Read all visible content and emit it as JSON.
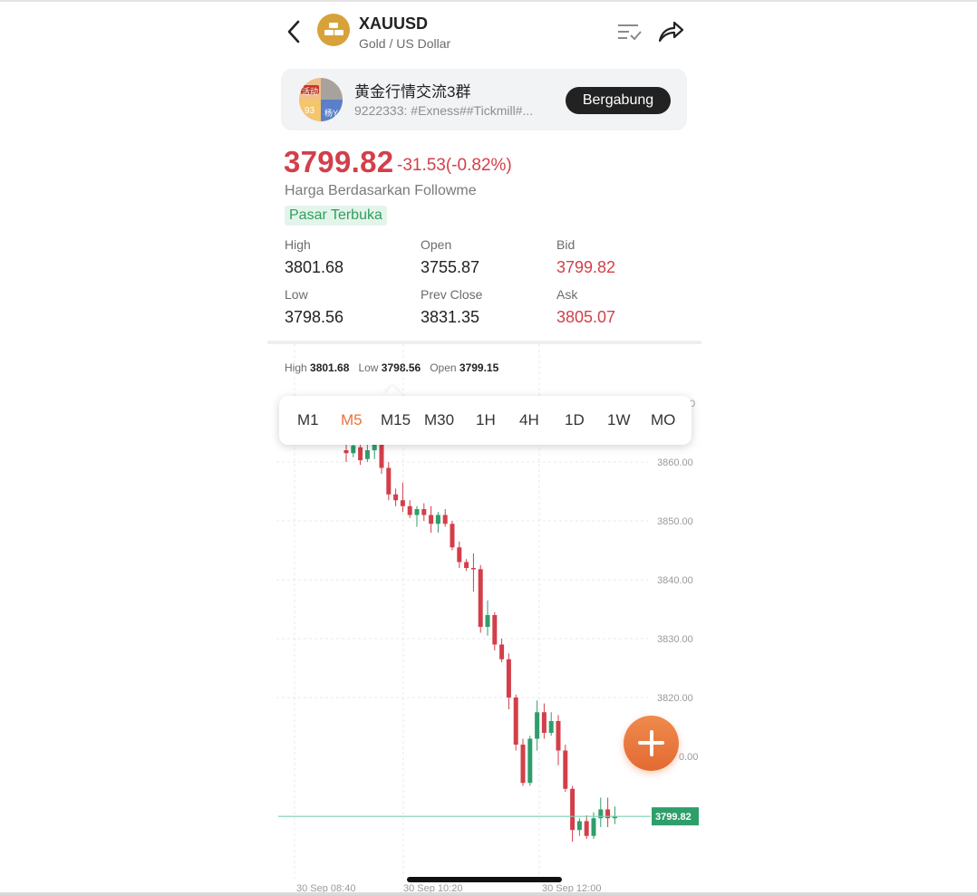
{
  "header": {
    "symbol": "XAUUSD",
    "name": "Gold / US Dollar"
  },
  "group": {
    "title": "黄金行情交流3群",
    "description": "9222333: #Exness##Tickmill#...",
    "join_label": "Bergabung",
    "avatar_texts": [
      "活动",
      "93",
      "杨Y"
    ]
  },
  "quote": {
    "price": "3799.82",
    "change": "-31.53(-0.82%)",
    "source": "Harga Berdasarkan Followme",
    "status": "Pasar Terbuka",
    "stats": [
      {
        "label": "High",
        "value": "3801.68",
        "tone": "normal"
      },
      {
        "label": "Open",
        "value": "3755.87",
        "tone": "normal"
      },
      {
        "label": "Bid",
        "value": "3799.82",
        "tone": "red"
      },
      {
        "label": "Low",
        "value": "3798.56",
        "tone": "normal"
      },
      {
        "label": "Prev Close",
        "value": "3831.35",
        "tone": "normal"
      },
      {
        "label": "Ask",
        "value": "3805.07",
        "tone": "red"
      }
    ]
  },
  "chart_header": {
    "high_label": "High",
    "high": "3801.68",
    "low_label": "Low",
    "low": "3798.56",
    "open_label": "Open",
    "open": "3799.15"
  },
  "timeframes": {
    "items": [
      "M1",
      "M5",
      "M15",
      "M30",
      "1H",
      "4H",
      "1D",
      "1W",
      "MO"
    ],
    "selected": "M5"
  },
  "colors": {
    "up": "#2e9e6b",
    "down": "#d23f4a",
    "accent": "#e8743d",
    "price_line": "#7fcfb0"
  },
  "icons": {
    "back": "chevron-left-icon",
    "list": "list-check-icon",
    "share": "share-icon",
    "fab": "plus-icon"
  },
  "chart_data": {
    "type": "candlestick",
    "y_ticks": [
      "3860.00",
      "3850.00",
      "3840.00",
      "3830.00",
      "3820.00"
    ],
    "y_partial_labels": [
      "0",
      "0.00"
    ],
    "x_ticks": [
      "30 Sep 08:40",
      "30 Sep 10:20",
      "30 Sep 12:00"
    ],
    "current_price_label": "3799.82",
    "candles": [
      {
        "o": 3862.0,
        "h": 3864.5,
        "l": 3860.0,
        "c": 3861.5
      },
      {
        "o": 3861.5,
        "h": 3863.0,
        "l": 3860.8,
        "c": 3862.8
      },
      {
        "o": 3862.5,
        "h": 3864.0,
        "l": 3859.5,
        "c": 3860.3
      },
      {
        "o": 3860.5,
        "h": 3863.0,
        "l": 3860.0,
        "c": 3862.0
      },
      {
        "o": 3862.0,
        "h": 3864.5,
        "l": 3860.5,
        "c": 3863.0
      },
      {
        "o": 3863.0,
        "h": 3864.0,
        "l": 3858.0,
        "c": 3859.0
      },
      {
        "o": 3859.0,
        "h": 3860.0,
        "l": 3853.5,
        "c": 3854.5
      },
      {
        "o": 3854.5,
        "h": 3855.5,
        "l": 3852.5,
        "c": 3853.5
      },
      {
        "o": 3853.5,
        "h": 3856.5,
        "l": 3851.5,
        "c": 3852.5
      },
      {
        "o": 3852.5,
        "h": 3853.5,
        "l": 3850.5,
        "c": 3851.0
      },
      {
        "o": 3851.0,
        "h": 3852.5,
        "l": 3849.0,
        "c": 3852.0
      },
      {
        "o": 3852.0,
        "h": 3853.0,
        "l": 3850.0,
        "c": 3851.0
      },
      {
        "o": 3851.0,
        "h": 3852.5,
        "l": 3848.0,
        "c": 3849.5
      },
      {
        "o": 3849.5,
        "h": 3851.5,
        "l": 3848.0,
        "c": 3851.0
      },
      {
        "o": 3851.0,
        "h": 3852.0,
        "l": 3849.0,
        "c": 3849.5
      },
      {
        "o": 3849.5,
        "h": 3850.0,
        "l": 3845.0,
        "c": 3845.5
      },
      {
        "o": 3845.5,
        "h": 3846.5,
        "l": 3842.0,
        "c": 3843.0
      },
      {
        "o": 3843.0,
        "h": 3843.5,
        "l": 3841.5,
        "c": 3842.0
      },
      {
        "o": 3842.0,
        "h": 3844.5,
        "l": 3838.0,
        "c": 3841.8
      },
      {
        "o": 3841.8,
        "h": 3842.5,
        "l": 3831.0,
        "c": 3832.0
      },
      {
        "o": 3832.0,
        "h": 3836.5,
        "l": 3830.5,
        "c": 3834.0
      },
      {
        "o": 3834.0,
        "h": 3834.5,
        "l": 3828.0,
        "c": 3829.0
      },
      {
        "o": 3829.0,
        "h": 3830.0,
        "l": 3826.0,
        "c": 3826.5
      },
      {
        "o": 3826.5,
        "h": 3827.5,
        "l": 3818.0,
        "c": 3820.0
      },
      {
        "o": 3820.0,
        "h": 3820.5,
        "l": 3811.0,
        "c": 3812.0
      },
      {
        "o": 3812.0,
        "h": 3813.0,
        "l": 3805.0,
        "c": 3805.5
      },
      {
        "o": 3805.5,
        "h": 3813.5,
        "l": 3805.0,
        "c": 3813.0
      },
      {
        "o": 3813.0,
        "h": 3819.5,
        "l": 3811.0,
        "c": 3817.5
      },
      {
        "o": 3817.5,
        "h": 3819.0,
        "l": 3813.0,
        "c": 3814.0
      },
      {
        "o": 3814.0,
        "h": 3817.5,
        "l": 3813.5,
        "c": 3816.0
      },
      {
        "o": 3816.0,
        "h": 3817.0,
        "l": 3808.5,
        "c": 3811.0
      },
      {
        "o": 3811.0,
        "h": 3812.0,
        "l": 3804.0,
        "c": 3804.5
      },
      {
        "o": 3804.5,
        "h": 3805.0,
        "l": 3795.5,
        "c": 3797.5
      },
      {
        "o": 3797.5,
        "h": 3799.5,
        "l": 3796.5,
        "c": 3799.0
      },
      {
        "o": 3799.0,
        "h": 3800.0,
        "l": 3796.0,
        "c": 3796.5
      },
      {
        "o": 3796.5,
        "h": 3800.5,
        "l": 3796.0,
        "c": 3799.5
      },
      {
        "o": 3799.5,
        "h": 3803.0,
        "l": 3798.0,
        "c": 3801.0
      },
      {
        "o": 3801.0,
        "h": 3803.0,
        "l": 3798.0,
        "c": 3799.5
      },
      {
        "o": 3799.5,
        "h": 3801.5,
        "l": 3798.5,
        "c": 3799.82
      }
    ]
  }
}
